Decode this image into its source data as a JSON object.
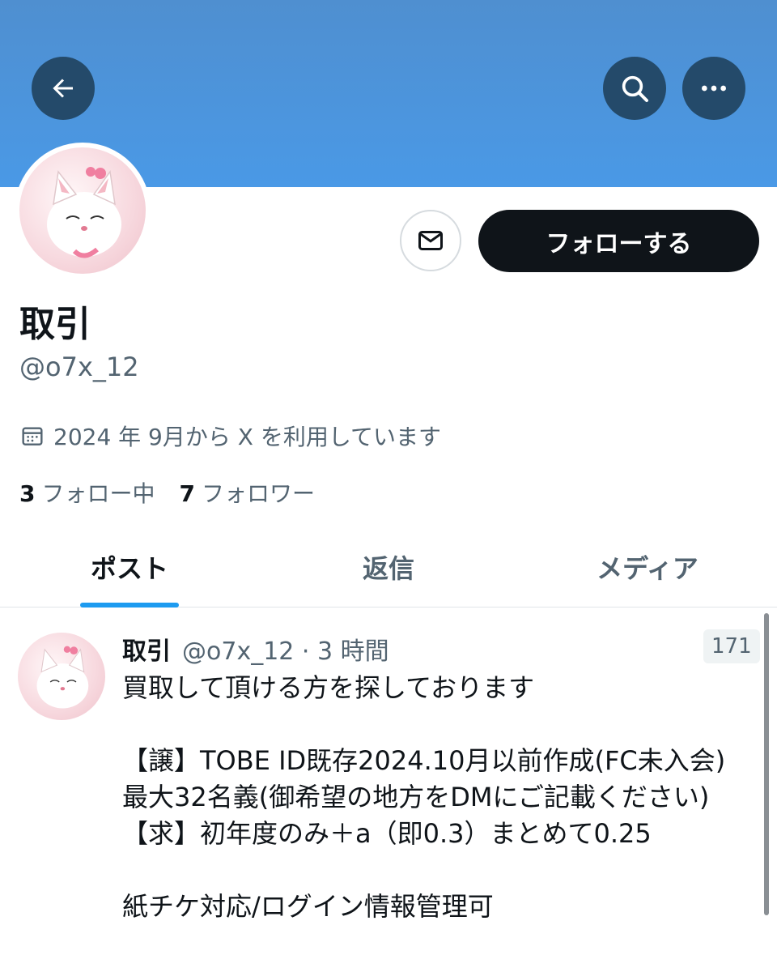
{
  "header": {
    "back_icon": "arrow-left-icon",
    "search_icon": "search-icon",
    "more_icon": "more-horizontal-icon",
    "banner_color": "#4a99e6"
  },
  "profile": {
    "display_name": "取引",
    "handle": "@o7x_12",
    "joined": "2024 年 9月から X を利用しています",
    "following_count": "3",
    "following_label": "フォロー中",
    "followers_count": "7",
    "followers_label": "フォロワー",
    "follow_button": "フォローする",
    "dm_icon": "mail-icon"
  },
  "tabs": [
    {
      "label": "ポスト",
      "active": true
    },
    {
      "label": "返信",
      "active": false
    },
    {
      "label": "メディア",
      "active": false
    }
  ],
  "post": {
    "name": "取引",
    "meta": "@o7x_12 · 3 時間",
    "count": "171",
    "lines": [
      "買取して頂ける方を探しております",
      "",
      "【譲】TOBE ID既存2024.10月以前作成(FC未入会)",
      "最大32名義(御希望の地方をDMにご記載ください)",
      "【求】初年度のみ＋a（即0.3）まとめて0.25",
      "",
      "紙チケ対応/ログイン情報管理可"
    ]
  },
  "colors": {
    "accent": "#1d9bf0",
    "follow_button_bg": "#0f1419",
    "secondary_text": "#536471"
  }
}
